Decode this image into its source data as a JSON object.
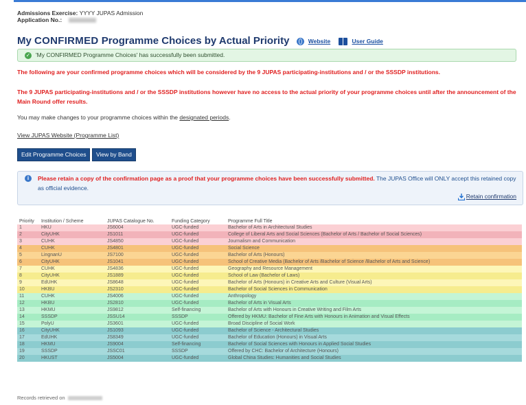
{
  "header": {
    "exercise_label": "Admissions Exercise:",
    "exercise_value": "YYYY JUPAS Admission",
    "app_no_label": "Application No.:"
  },
  "title": {
    "prefix": "My ",
    "emphasis": "CONFIRMED",
    "suffix": " Programme Choices by Actual Priority",
    "website_link": "Website",
    "guide_link": "User Guide"
  },
  "success_message": "'My CONFIRMED Programme Choices' has successfully been submitted.",
  "notice_red_1": "The following are your confirmed programme choices which will be considered by the 9 JUPAS participating-institutions and / or the SSSDP institutions.",
  "notice_red_2": "The 9 JUPAS participating-institutions and / or the SSSDP institutions however have no access to the actual priority of your programme choices until after the announcement of the Main Round offer results.",
  "changes_text": "You may make changes to your programme choices within the ",
  "changes_link": "designated periods",
  "changes_end": ".",
  "view_jupas_link": "View JUPAS Website (Programme List)",
  "buttons": {
    "edit": "Edit Programme Choices",
    "view_band": "View by Band"
  },
  "retain_notice": {
    "red": "Please retain a copy of the confirmation page as a proof that your programme choices have been successfully submitted.",
    "blue": " The JUPAS Office will ONLY accept this retained copy as official evidence.",
    "link": "Retain confirmation"
  },
  "table": {
    "headers": [
      "Priority",
      "Institution / Scheme",
      "JUPAS Catalogue No.",
      "Funding Category",
      "Programme Full Title"
    ],
    "rows": [
      {
        "p": "1",
        "inst": "HKU",
        "code": "JS6004",
        "fund": "UGC-funded",
        "title": "Bachelor of Arts in Architectural Studies",
        "bg": "#fbd0d4"
      },
      {
        "p": "2",
        "inst": "CityUHK",
        "code": "JS1011",
        "fund": "UGC-funded",
        "title": "College of Liberal Arts and Social Sciences (Bachelor of Arts / Bachelor of Social Sciences)",
        "bg": "#f2b3ba"
      },
      {
        "p": "3",
        "inst": "CUHK",
        "code": "JS4850",
        "fund": "UGC-funded",
        "title": "Journalism and Communication",
        "bg": "#fbd0d4"
      },
      {
        "p": "4",
        "inst": "CUHK",
        "code": "JS4801",
        "fund": "UGC-funded",
        "title": "Social Science",
        "bg": "#f6c27a"
      },
      {
        "p": "5",
        "inst": "LingnanU",
        "code": "JS7100",
        "fund": "UGC-funded",
        "title": "Bachelor of Arts (Honours)",
        "bg": "#fbd593"
      },
      {
        "p": "6",
        "inst": "CityUHK",
        "code": "JS1041",
        "fund": "UGC-funded",
        "title": "School of Creative Media (Bachelor of Arts /Bachelor of Science /Bachelor of Arts and Science)",
        "bg": "#f6c27a"
      },
      {
        "p": "7",
        "inst": "CUHK",
        "code": "JS4836",
        "fund": "UGC-funded",
        "title": "Geography and Resource Management",
        "bg": "#fdf6b8"
      },
      {
        "p": "8",
        "inst": "CityUHK",
        "code": "JS1889",
        "fund": "UGC-funded",
        "title": "School of Law (Bachelor of Laws)",
        "bg": "#f6ec8e"
      },
      {
        "p": "9",
        "inst": "EdUHK",
        "code": "JS8648",
        "fund": "UGC-funded",
        "title": "Bachelor of Arts (Honours) in Creative Arts and Culture (Visual Arts)",
        "bg": "#fdf6b8"
      },
      {
        "p": "10",
        "inst": "HKBU",
        "code": "JS2310",
        "fund": "UGC-funded",
        "title": "Bachelor of Social Sciences in Communication",
        "bg": "#f6ec8e"
      },
      {
        "p": "11",
        "inst": "CUHK",
        "code": "JS4006",
        "fund": "UGC-funded",
        "title": "Anthropology",
        "bg": "#c4f5d6"
      },
      {
        "p": "12",
        "inst": "HKBU",
        "code": "JS2810",
        "fund": "UGC-funded",
        "title": "Bachelor of Arts in Visual Arts",
        "bg": "#a6ecc3"
      },
      {
        "p": "13",
        "inst": "HKMU",
        "code": "JS9812",
        "fund": "Self-financing",
        "title": "Bachelor of Arts with Honours in Creative Writing and Film Arts",
        "bg": "#c4f5d6"
      },
      {
        "p": "14",
        "inst": "SSSDP",
        "code": "JSSU14",
        "fund": "SSSDP",
        "title": "Offered by HKMU: Bachelor of Fine Arts with Honours in Animation and Visual Effects",
        "bg": "#a6ecc3"
      },
      {
        "p": "15",
        "inst": "PolyU",
        "code": "JS3601",
        "fund": "UGC-funded",
        "title": "Broad Discipline of Social Work",
        "bg": "#c4f5d6"
      },
      {
        "p": "16",
        "inst": "CityUHK",
        "code": "JS1093",
        "fund": "UGC-funded",
        "title": "Bachelor of Science - Architectural Studies",
        "bg": "#8ccccf"
      },
      {
        "p": "17",
        "inst": "EdUHK",
        "code": "JS8349",
        "fund": "UGC-funded",
        "title": "Bachelor of Education (Honours) in Visual Arts",
        "bg": "#a6dadc"
      },
      {
        "p": "18",
        "inst": "HKMU",
        "code": "JS9004",
        "fund": "Self-financing",
        "title": "Bachelor of Social Sciences with Honours in Applied Social Studies",
        "bg": "#8ccccf"
      },
      {
        "p": "19",
        "inst": "SSSDP",
        "code": "JSSC01",
        "fund": "SSSDP",
        "title": "Offered by CHC: Bachelor of Architecture (Honours)",
        "bg": "#a6dadc"
      },
      {
        "p": "20",
        "inst": "HKUST",
        "code": "JS5004",
        "fund": "UGC-funded",
        "title": "Global China Studies: Humanities and Social Studies",
        "bg": "#8ccccf"
      }
    ]
  },
  "footer_text": "Records retrieved on",
  "colors": {
    "title": "#1f3a6e",
    "alert_red": "#e02020",
    "button": "#1f4e8c",
    "success_bg": "#e3f6e4"
  }
}
